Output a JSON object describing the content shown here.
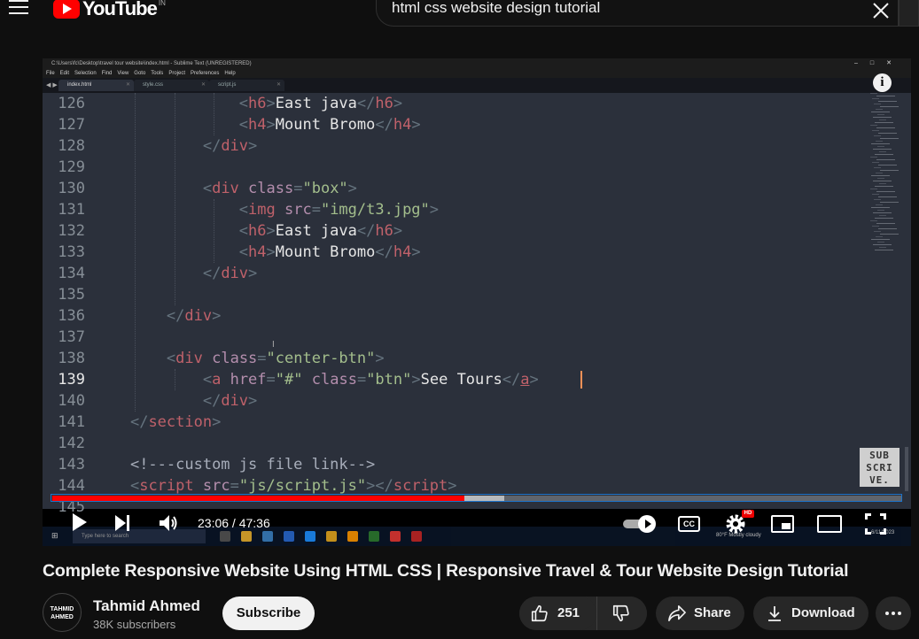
{
  "search": {
    "query": "html css website design tutorial"
  },
  "logo": {
    "text": "YouTube",
    "sup": "IN"
  },
  "editor": {
    "window_title": "C:\\Users\\fc\\Desktop\\travel tour website\\index.html - Sublime Text (UNREGISTERED)",
    "menu": [
      "File",
      "Edit",
      "Selection",
      "Find",
      "View",
      "Goto",
      "Tools",
      "Project",
      "Preferences",
      "Help"
    ],
    "tabs": [
      "index.html",
      "style.css",
      "script.js"
    ],
    "line_numbers": [
      "126",
      "127",
      "128",
      "129",
      "130",
      "131",
      "132",
      "133",
      "134",
      "135",
      "136",
      "137",
      "138",
      "139",
      "140",
      "141",
      "142",
      "143",
      "144",
      "145"
    ],
    "current_line": "139"
  },
  "watermark": {
    "text": "SUB SCRI VE."
  },
  "taskbar": {
    "search_placeholder": "Type here to search",
    "weather": "80°F  Mostly cloudy",
    "time": "6/11/2023"
  },
  "player": {
    "current_time": "23:06",
    "duration": "47:36",
    "time_display": "23:06 / 47:36",
    "played_fraction": 0.485,
    "buffered_fraction": 0.532,
    "cc_label": "CC",
    "hd_badge": "HD"
  },
  "video": {
    "title": "Complete Responsive Website Using HTML CSS | Responsive Travel & Tour Website Design Tutorial",
    "channel": "Tahmid Ahmed",
    "avatar_text": "TAHMID AHMED",
    "subscribers": "38K subscribers",
    "subscribe_label": "Subscribe",
    "likes": "251",
    "share_label": "Share",
    "download_label": "Download"
  },
  "colors": {
    "accent": "#ff0000",
    "progress_outline": "#1e73c8",
    "editor_bg": "#2b303b"
  }
}
